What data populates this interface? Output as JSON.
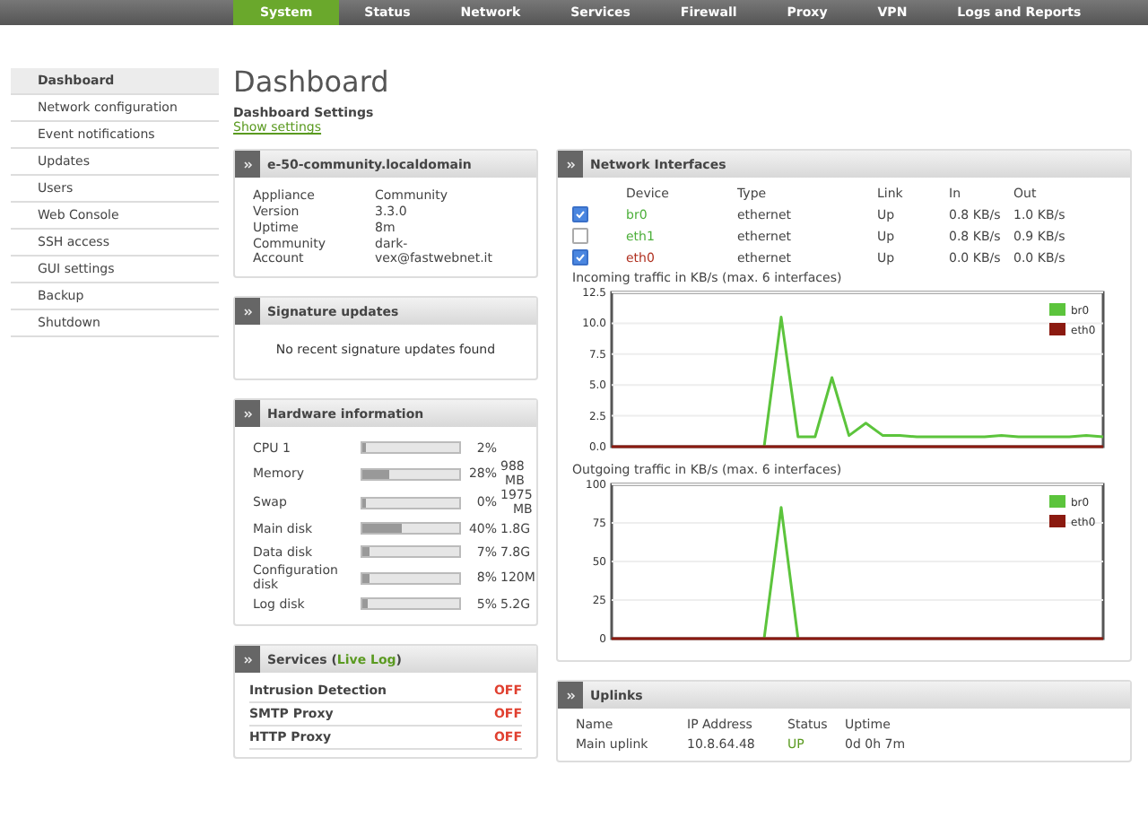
{
  "nav": {
    "tabs": [
      {
        "label": "System",
        "selected": true
      },
      {
        "label": "Status",
        "selected": false
      },
      {
        "label": "Network",
        "selected": false
      },
      {
        "label": "Services",
        "selected": false
      },
      {
        "label": "Firewall",
        "selected": false
      },
      {
        "label": "Proxy",
        "selected": false
      },
      {
        "label": "VPN",
        "selected": false
      },
      {
        "label": "Logs and Reports",
        "selected": false
      }
    ]
  },
  "sidebar": {
    "items": [
      {
        "label": "Dashboard",
        "selected": true
      },
      {
        "label": "Network configuration",
        "selected": false
      },
      {
        "label": "Event notifications",
        "selected": false
      },
      {
        "label": "Updates",
        "selected": false
      },
      {
        "label": "Users",
        "selected": false
      },
      {
        "label": "Web Console",
        "selected": false
      },
      {
        "label": "SSH access",
        "selected": false
      },
      {
        "label": "GUI settings",
        "selected": false
      },
      {
        "label": "Backup",
        "selected": false
      },
      {
        "label": "Shutdown",
        "selected": false
      }
    ]
  },
  "page": {
    "title": "Dashboard",
    "subtitle": "Dashboard Settings",
    "link": "Show settings"
  },
  "host_panel": {
    "title": "e-50-community.localdomain",
    "rows": [
      {
        "label": "Appliance",
        "value": "Community"
      },
      {
        "label": "Version",
        "value": "3.3.0"
      },
      {
        "label": "Uptime",
        "value": "8m"
      },
      {
        "label": "Community Account",
        "value": "dark-vex@fastwebnet.it"
      }
    ]
  },
  "signature_panel": {
    "title": "Signature updates",
    "message": "No recent signature updates found"
  },
  "hardware_panel": {
    "title": "Hardware information",
    "rows": [
      {
        "label": "CPU 1",
        "level": 0.02,
        "percent": "2%"
      },
      {
        "label": "Memory",
        "level": 0.28,
        "percent": "28%",
        "size": "988 MB"
      },
      {
        "label": "Swap",
        "level": 0.0,
        "percent": "0%",
        "size": "1975 MB"
      },
      {
        "label": "Main disk",
        "level": 0.4,
        "percent": "40%",
        "size": "1.8G"
      },
      {
        "label": "Data disk",
        "level": 0.07,
        "percent": "7%",
        "size": "7.8G"
      },
      {
        "label": "Configuration disk",
        "level": 0.08,
        "percent": "8%",
        "size": "120M"
      },
      {
        "label": "Log disk",
        "level": 0.05,
        "percent": "5%",
        "size": "5.2G"
      }
    ]
  },
  "services_panel": {
    "title": "Services (",
    "link": "Live Log",
    "title_end": ")",
    "rows": [
      {
        "name": "Intrusion Detection",
        "status": "OFF"
      },
      {
        "name": "SMTP Proxy",
        "status": "OFF"
      },
      {
        "name": "HTTP Proxy",
        "status": "OFF"
      }
    ]
  },
  "network_panel": {
    "title": "Network Interfaces",
    "columns": [
      "Device",
      "Type",
      "Link",
      "In",
      "Out"
    ],
    "interfaces": [
      {
        "device": "br0",
        "type": "ethernet",
        "link": "Up",
        "in": "0.8 KB/s",
        "out": "1.0 KB/s",
        "checked": true,
        "color": "#4caf3a"
      },
      {
        "device": "eth1",
        "type": "ethernet",
        "link": "Up",
        "in": "0.8 KB/s",
        "out": "0.9 KB/s",
        "checked": false,
        "color": "#4caf3a"
      },
      {
        "device": "eth0",
        "type": "ethernet",
        "link": "Up",
        "in": "0.0 KB/s",
        "out": "0.0 KB/s",
        "checked": true,
        "color": "#b03020"
      }
    ],
    "charts": [
      {
        "caption": "Incoming traffic in KB/s (max. 6 interfaces)",
        "chart_data": {
          "type": "line",
          "grid": true,
          "legend": true,
          "ylim": [
            0,
            12.5
          ],
          "yticks": [
            {
              "value": 0,
              "label": "0.0"
            },
            {
              "value": 2.5,
              "label": "2.5"
            },
            {
              "value": 5,
              "label": "5.0"
            },
            {
              "value": 7.5,
              "label": "7.5"
            },
            {
              "value": 10,
              "label": "10.0"
            },
            {
              "value": 12.5,
              "label": "12.5"
            }
          ],
          "series": [
            {
              "name": "br0",
              "color": "#5cc43c",
              "values": [
                null,
                null,
                null,
                null,
                null,
                null,
                null,
                null,
                null,
                0,
                10.5,
                0.8,
                0.8,
                5.6,
                0.9,
                1.9,
                0.9,
                0.9,
                0.8,
                0.8,
                0.8,
                0.8,
                0.8,
                0.9,
                0.8,
                0.8,
                0.8,
                0.8,
                0.9,
                0.8
              ]
            },
            {
              "name": "eth0",
              "color": "#8b1a10",
              "values": [
                0,
                0,
                0,
                0,
                0,
                0,
                0,
                0,
                0,
                0,
                0,
                0,
                0,
                0,
                0,
                0,
                0,
                0,
                0,
                0,
                0,
                0,
                0,
                0,
                0,
                0,
                0,
                0,
                0,
                0
              ]
            }
          ]
        }
      },
      {
        "caption": "Outgoing traffic in KB/s (max. 6 interfaces)",
        "chart_data": {
          "type": "line",
          "grid": true,
          "legend": true,
          "ylim": [
            0,
            100
          ],
          "yticks": [
            0,
            25,
            50,
            75,
            100
          ],
          "series": [
            {
              "name": "br0",
              "color": "#5cc43c",
              "values": [
                null,
                null,
                null,
                null,
                null,
                null,
                null,
                null,
                null,
                0,
                85,
                0,
                null,
                null,
                null,
                null,
                null,
                null,
                null,
                null,
                null,
                null,
                null,
                null,
                null,
                null,
                null,
                null,
                null,
                null
              ]
            },
            {
              "name": "eth0",
              "color": "#8b1a10",
              "values": [
                0,
                0,
                0,
                0,
                0,
                0,
                0,
                0,
                0,
                0,
                0,
                0,
                0,
                0,
                0,
                0,
                0,
                0,
                0,
                0,
                0,
                0,
                0,
                0,
                0,
                0,
                0,
                0,
                0,
                0
              ]
            }
          ]
        }
      }
    ]
  },
  "uplinks_panel": {
    "title": "Uplinks",
    "columns": [
      "Name",
      "IP Address",
      "Status",
      "Uptime"
    ],
    "rows": [
      {
        "name": "Main uplink",
        "ip": "10.8.64.48",
        "status": "UP",
        "uptime": "0d 0h 7m"
      }
    ]
  }
}
